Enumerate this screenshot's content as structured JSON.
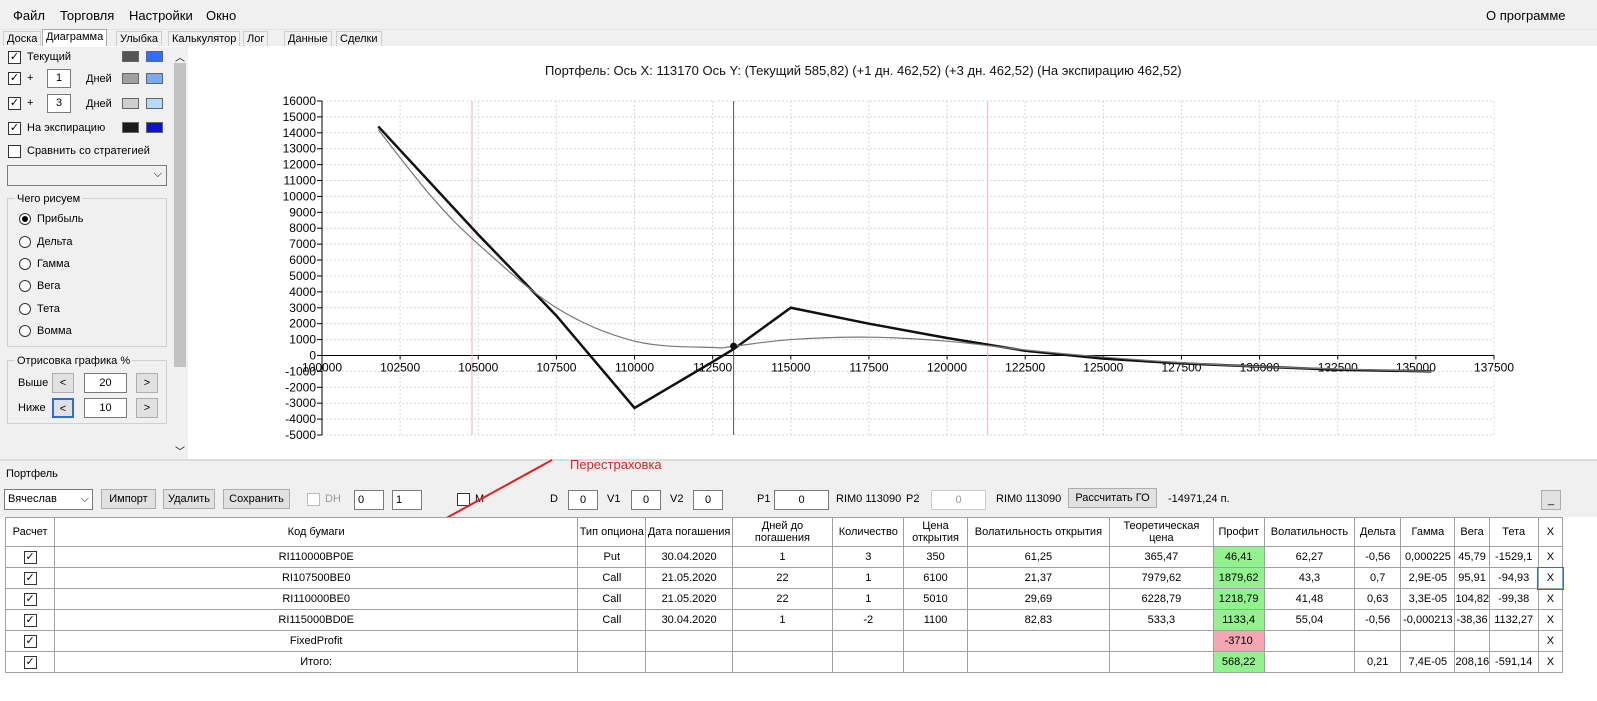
{
  "menu": {
    "file": "Файл",
    "trade": "Торговля",
    "settings": "Настройки",
    "window": "Окно",
    "about": "О программе"
  },
  "tabs": [
    "Доска",
    "Диаграмма",
    "Улыбка",
    "Калькулятор",
    "Лог",
    "Данные",
    "Сделки"
  ],
  "left": {
    "current_label": "Текущий",
    "plus": "+",
    "days_label": "Дней",
    "days1": "1",
    "days2": "3",
    "expiry_label": "На экспирацию",
    "compare_label": "Сравнить со стратегией",
    "draw_group": "Чего рисуем",
    "radios": [
      "Прибыль",
      "Дельта",
      "Гамма",
      "Вега",
      "Тета",
      "Вомма"
    ],
    "render_group": "Отрисовка графика %",
    "above": "Выше",
    "below": "Ниже",
    "above_val": "20",
    "below_val": "10",
    "btn_left": "<",
    "btn_right": ">"
  },
  "colors": {
    "current": [
      "#555555",
      "#2f6ff0"
    ],
    "plus1": [
      "#a0a0a0",
      "#7aaaf0"
    ],
    "plus3": [
      "#cfcfcf",
      "#b6dafa"
    ],
    "expiry": [
      "#1a1a1a",
      "#1010d0"
    ],
    "profit_pos": "#92f28e",
    "profit_neg": "#f6a6b2"
  },
  "chart_data": {
    "type": "line",
    "title": "Портфель: Ось X:  113170 Ось Y:   (Текущий 585,82)   (+1 дн. 462,52)   (+3 дн. 462,52)   (На экспирацию 462,52)",
    "xlim": [
      100000,
      137500
    ],
    "ylim": [
      -5000,
      16000
    ],
    "xticks": [
      100000,
      102500,
      105000,
      107500,
      110000,
      112500,
      115000,
      117500,
      120000,
      122500,
      125000,
      127500,
      130000,
      132500,
      135000,
      137500
    ],
    "yticks": [
      16000,
      15000,
      14000,
      13000,
      12000,
      11000,
      10000,
      9000,
      8000,
      7000,
      6000,
      5000,
      4000,
      3000,
      2000,
      1000,
      0,
      -1000,
      -2000,
      -3000,
      -4000,
      -5000
    ],
    "grid": true,
    "markers_x": [
      104800,
      113170,
      121300
    ],
    "current_point": [
      113170,
      586
    ],
    "series": [
      {
        "values_x": [
          101800,
          105000,
          107500,
          110000,
          112500,
          113170,
          115000,
          117500,
          120000,
          122500,
          125000,
          127500,
          130000,
          132500,
          135500
        ],
        "values_y": [
          14400,
          7600,
          2500,
          -3300,
          -400,
          400,
          3000,
          2000,
          1100,
          300,
          -200,
          -500,
          -700,
          -900,
          -1000
        ]
      },
      {
        "values_x": [
          101800,
          103500,
          105000,
          107500,
          110000,
          112500,
          113170,
          115000,
          117500,
          120000,
          122500,
          125000,
          127500,
          130000,
          132500,
          135500
        ],
        "values_y": [
          14200,
          10000,
          7000,
          3000,
          900,
          500,
          580,
          1000,
          1150,
          900,
          350,
          -100,
          -450,
          -700,
          -850,
          -1000
        ]
      }
    ]
  },
  "portfolio": {
    "section": "Портфель",
    "account": "Вячеслав",
    "import": "Импорт",
    "delete": "Удалить",
    "save": "Сохранить",
    "dh": "DH",
    "spin1": "0",
    "spin2": "1",
    "m": "M",
    "d_label": "D",
    "d_val": "0",
    "v1_label": "V1",
    "v1_val": "0",
    "v2_label": "V2",
    "v2_val": "0",
    "p1_label": "P1",
    "p1_val": "0",
    "rim1": "RIM0 113090",
    "p2_label": "P2",
    "p2_val": "0",
    "rim2": "RIM0 113090",
    "calc_go": "Рассчитать ГО",
    "total": "-14971,24 п.",
    "minimize": "_"
  },
  "annotation": "Перестраховка",
  "table": {
    "headers": [
      "Расчет",
      "Код бумаги",
      "Тип опциона",
      "Дата погашения",
      "Дней до погашения",
      "Количество",
      "Цена открытия",
      "Волатильность открытия",
      "Теоретическая цена",
      "Профит",
      "Волатильность",
      "Дельта",
      "Гамма",
      "Вега",
      "Тета",
      "X"
    ],
    "rows": [
      [
        "✓",
        "RI110000BP0E",
        "Put",
        "30.04.2020",
        "1",
        "3",
        "350",
        "61,25",
        "365,47",
        "46,41",
        "62,27",
        "-0,56",
        "0,000225",
        "45,79",
        "-1529,1",
        "X"
      ],
      [
        "✓",
        "RI107500BE0",
        "Call",
        "21.05.2020",
        "22",
        "1",
        "6100",
        "21,37",
        "7979,62",
        "1879,62",
        "43,3",
        "0,7",
        "2,9E-05",
        "95,91",
        "-94,93",
        "X"
      ],
      [
        "✓",
        "RI110000BE0",
        "Call",
        "21.05.2020",
        "22",
        "1",
        "5010",
        "29,69",
        "6228,79",
        "1218,79",
        "41,48",
        "0,63",
        "3,3E-05",
        "104,82",
        "-99,38",
        "X"
      ],
      [
        "✓",
        "RI115000BD0E",
        "Call",
        "30.04.2020",
        "1",
        "-2",
        "1100",
        "82,83",
        "533,3",
        "1133,4",
        "55,04",
        "-0,56",
        "-0,000213",
        "-38,36",
        "1132,27",
        "X"
      ],
      [
        "✓",
        "FixedProfit",
        "",
        "",
        "",
        "",
        "",
        "",
        "",
        "-3710",
        "",
        "",
        "",
        "",
        "",
        "X"
      ],
      [
        "✓",
        "Итого:",
        "",
        "",
        "",
        "",
        "",
        "",
        "",
        "568,22",
        "",
        "0,21",
        "7,4E-05",
        "208,16",
        "-591,14",
        "X"
      ]
    ]
  }
}
